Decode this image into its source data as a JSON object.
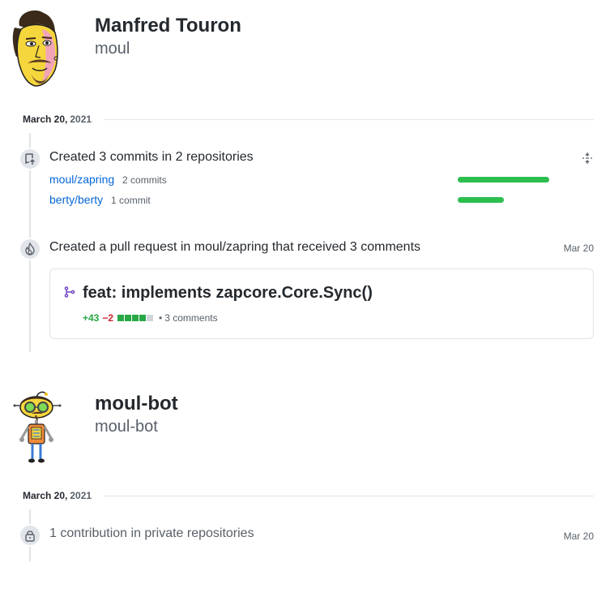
{
  "profiles": [
    {
      "name": "Manfred Touron",
      "login": "moul",
      "date": {
        "day": "March 20,",
        "year": "2021"
      },
      "activities": {
        "commits": {
          "title": "Created 3 commits in 2 repositories",
          "icon": "repo-push-icon",
          "repos": [
            {
              "name": "moul/zapring",
              "count": "2 commits",
              "share": 1.0
            },
            {
              "name": "berty/berty",
              "count": "1 commit",
              "share": 0.5
            }
          ],
          "collapse_icon": "fold-icon"
        },
        "pull_request": {
          "title": "Created a pull request in moul/zapring that received 3 comments",
          "date": "Mar 20",
          "icon": "flame-icon",
          "card": {
            "icon": "git-pull-request-icon",
            "title": "feat: implements zapcore.Core.Sync()",
            "additions": "+43",
            "deletions": "−2",
            "diff_blocks": [
              "green",
              "green",
              "green",
              "green",
              "neutral"
            ],
            "separator": "•",
            "comments": "3 comments"
          }
        }
      }
    },
    {
      "name": "moul-bot",
      "login": "moul-bot",
      "date": {
        "day": "March 20,",
        "year": "2021"
      },
      "activities": {
        "private": {
          "title": "1 contribution in private repositories",
          "date": "Mar 20",
          "icon": "lock-icon"
        }
      }
    }
  ],
  "colors": {
    "accent_link": "#0366d6",
    "bar_green": "#2cbe4e",
    "addition": "#28a745",
    "deletion": "#cb2431"
  }
}
